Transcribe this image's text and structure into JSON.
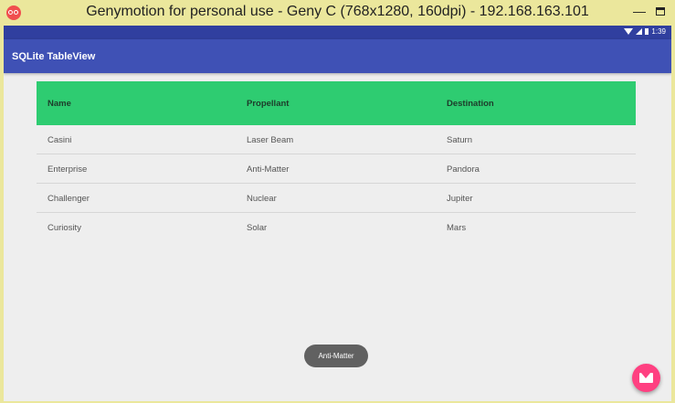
{
  "window": {
    "title": "Genymotion for personal use - Geny C (768x1280, 160dpi) - 192.168.163.101",
    "minimize_glyph": "—"
  },
  "status_bar": {
    "time": "1:39"
  },
  "app_bar": {
    "title": "SQLite TableView"
  },
  "table": {
    "headers": [
      "Name",
      "Propellant",
      "Destination"
    ],
    "rows": [
      [
        "Casini",
        "Laser Beam",
        "Saturn"
      ],
      [
        "Enterprise",
        "Anti-Matter",
        "Pandora"
      ],
      [
        "Challenger",
        "Nuclear",
        "Jupiter"
      ],
      [
        "Curiosity",
        "Solar",
        "Mars"
      ]
    ]
  },
  "toast": {
    "text": "Anti-Matter"
  },
  "fab": {
    "icon": "email-icon",
    "color": "#ff4081"
  },
  "colors": {
    "primary": "#3f51b5",
    "primary_dark": "#303f9f",
    "header_green": "#2ecc71",
    "window_chrome": "#ebe79c"
  }
}
